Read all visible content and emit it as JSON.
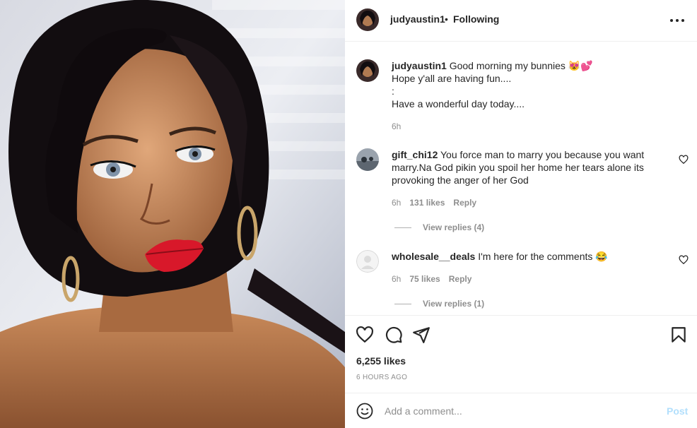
{
  "post": {
    "author": "judyaustin1",
    "separator": "•",
    "follow_status": "Following",
    "caption_line1": "Good morning my bunnies",
    "caption_emoji": "😻💕",
    "caption_line2": "Hope y'all are having fun....",
    "caption_line3": ":",
    "caption_line4": "Have a wonderful day today....",
    "caption_age": "6h",
    "likes": "6,255 likes",
    "timestamp": "6 HOURS AGO"
  },
  "comments": [
    {
      "user": "gift_chi12",
      "line1": "You force man to marry you because you want",
      "line2": "marry.Na God pikin you spoil her home her tears alone its",
      "line3": "provoking the anger of her God",
      "age": "6h",
      "likes": "131 likes",
      "reply": "Reply",
      "view_replies": "View replies (4)"
    },
    {
      "user": "wholesale__deals",
      "line1": "I'm here for the comments 😂",
      "age": "6h",
      "likes": "75 likes",
      "reply": "Reply",
      "view_replies": "View replies (1)"
    }
  ],
  "composer": {
    "placeholder": "Add a comment...",
    "post_label": "Post"
  },
  "icons": {
    "more": "more-options-icon",
    "like": "heart-icon",
    "comment": "comment-icon",
    "share": "share-icon",
    "save": "bookmark-icon",
    "emoji": "emoji-icon"
  },
  "colors": {
    "text": "#262626",
    "muted": "#8e8e8e",
    "post_disabled": "#b2dffc",
    "border": "#efefef"
  }
}
